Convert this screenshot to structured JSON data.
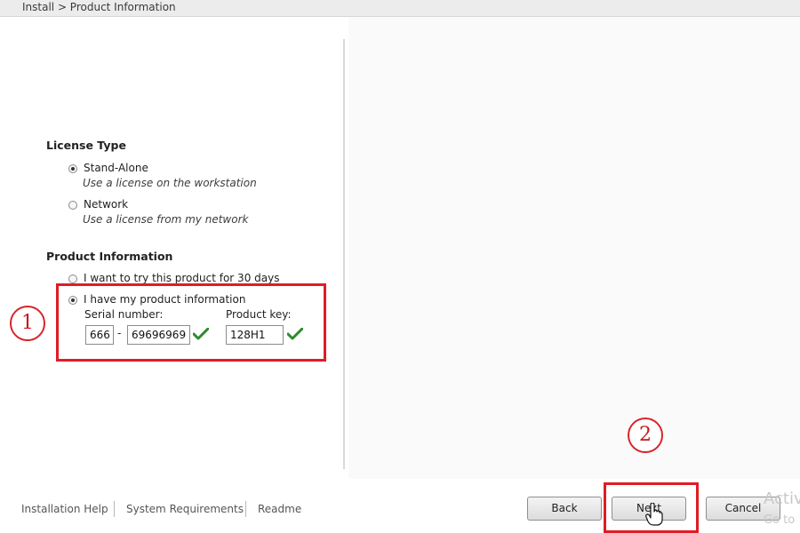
{
  "breadcrumb": "Install > Product Information",
  "license_type": {
    "title": "License Type",
    "options": [
      {
        "label": "Stand-Alone",
        "description": "Use a license on the workstation",
        "checked": true
      },
      {
        "label": "Network",
        "description": "Use a license from my network",
        "checked": false
      }
    ]
  },
  "product_info": {
    "title": "Product Information",
    "options": [
      {
        "label": "I want to try this product for 30 days",
        "checked": false
      },
      {
        "label": "I have my product information",
        "checked": true
      }
    ],
    "serial_label": "Serial number:",
    "serial_prefix": "666",
    "serial_separator": "-",
    "serial_number": "69696969",
    "product_key_label": "Product key:",
    "product_key": "128H1"
  },
  "annotations": {
    "step1": "1",
    "step2": "2",
    "color": "#e01c24"
  },
  "footer": {
    "links": [
      "Installation Help",
      "System Requirements",
      "Readme"
    ]
  },
  "buttons": {
    "back": "Back",
    "next": "Next",
    "cancel": "Cancel"
  },
  "watermark": {
    "line1": "Activ",
    "line2": "Go to"
  },
  "colors": {
    "valid_check": "#2e8b2e",
    "annotation_red": "#e01c24"
  }
}
